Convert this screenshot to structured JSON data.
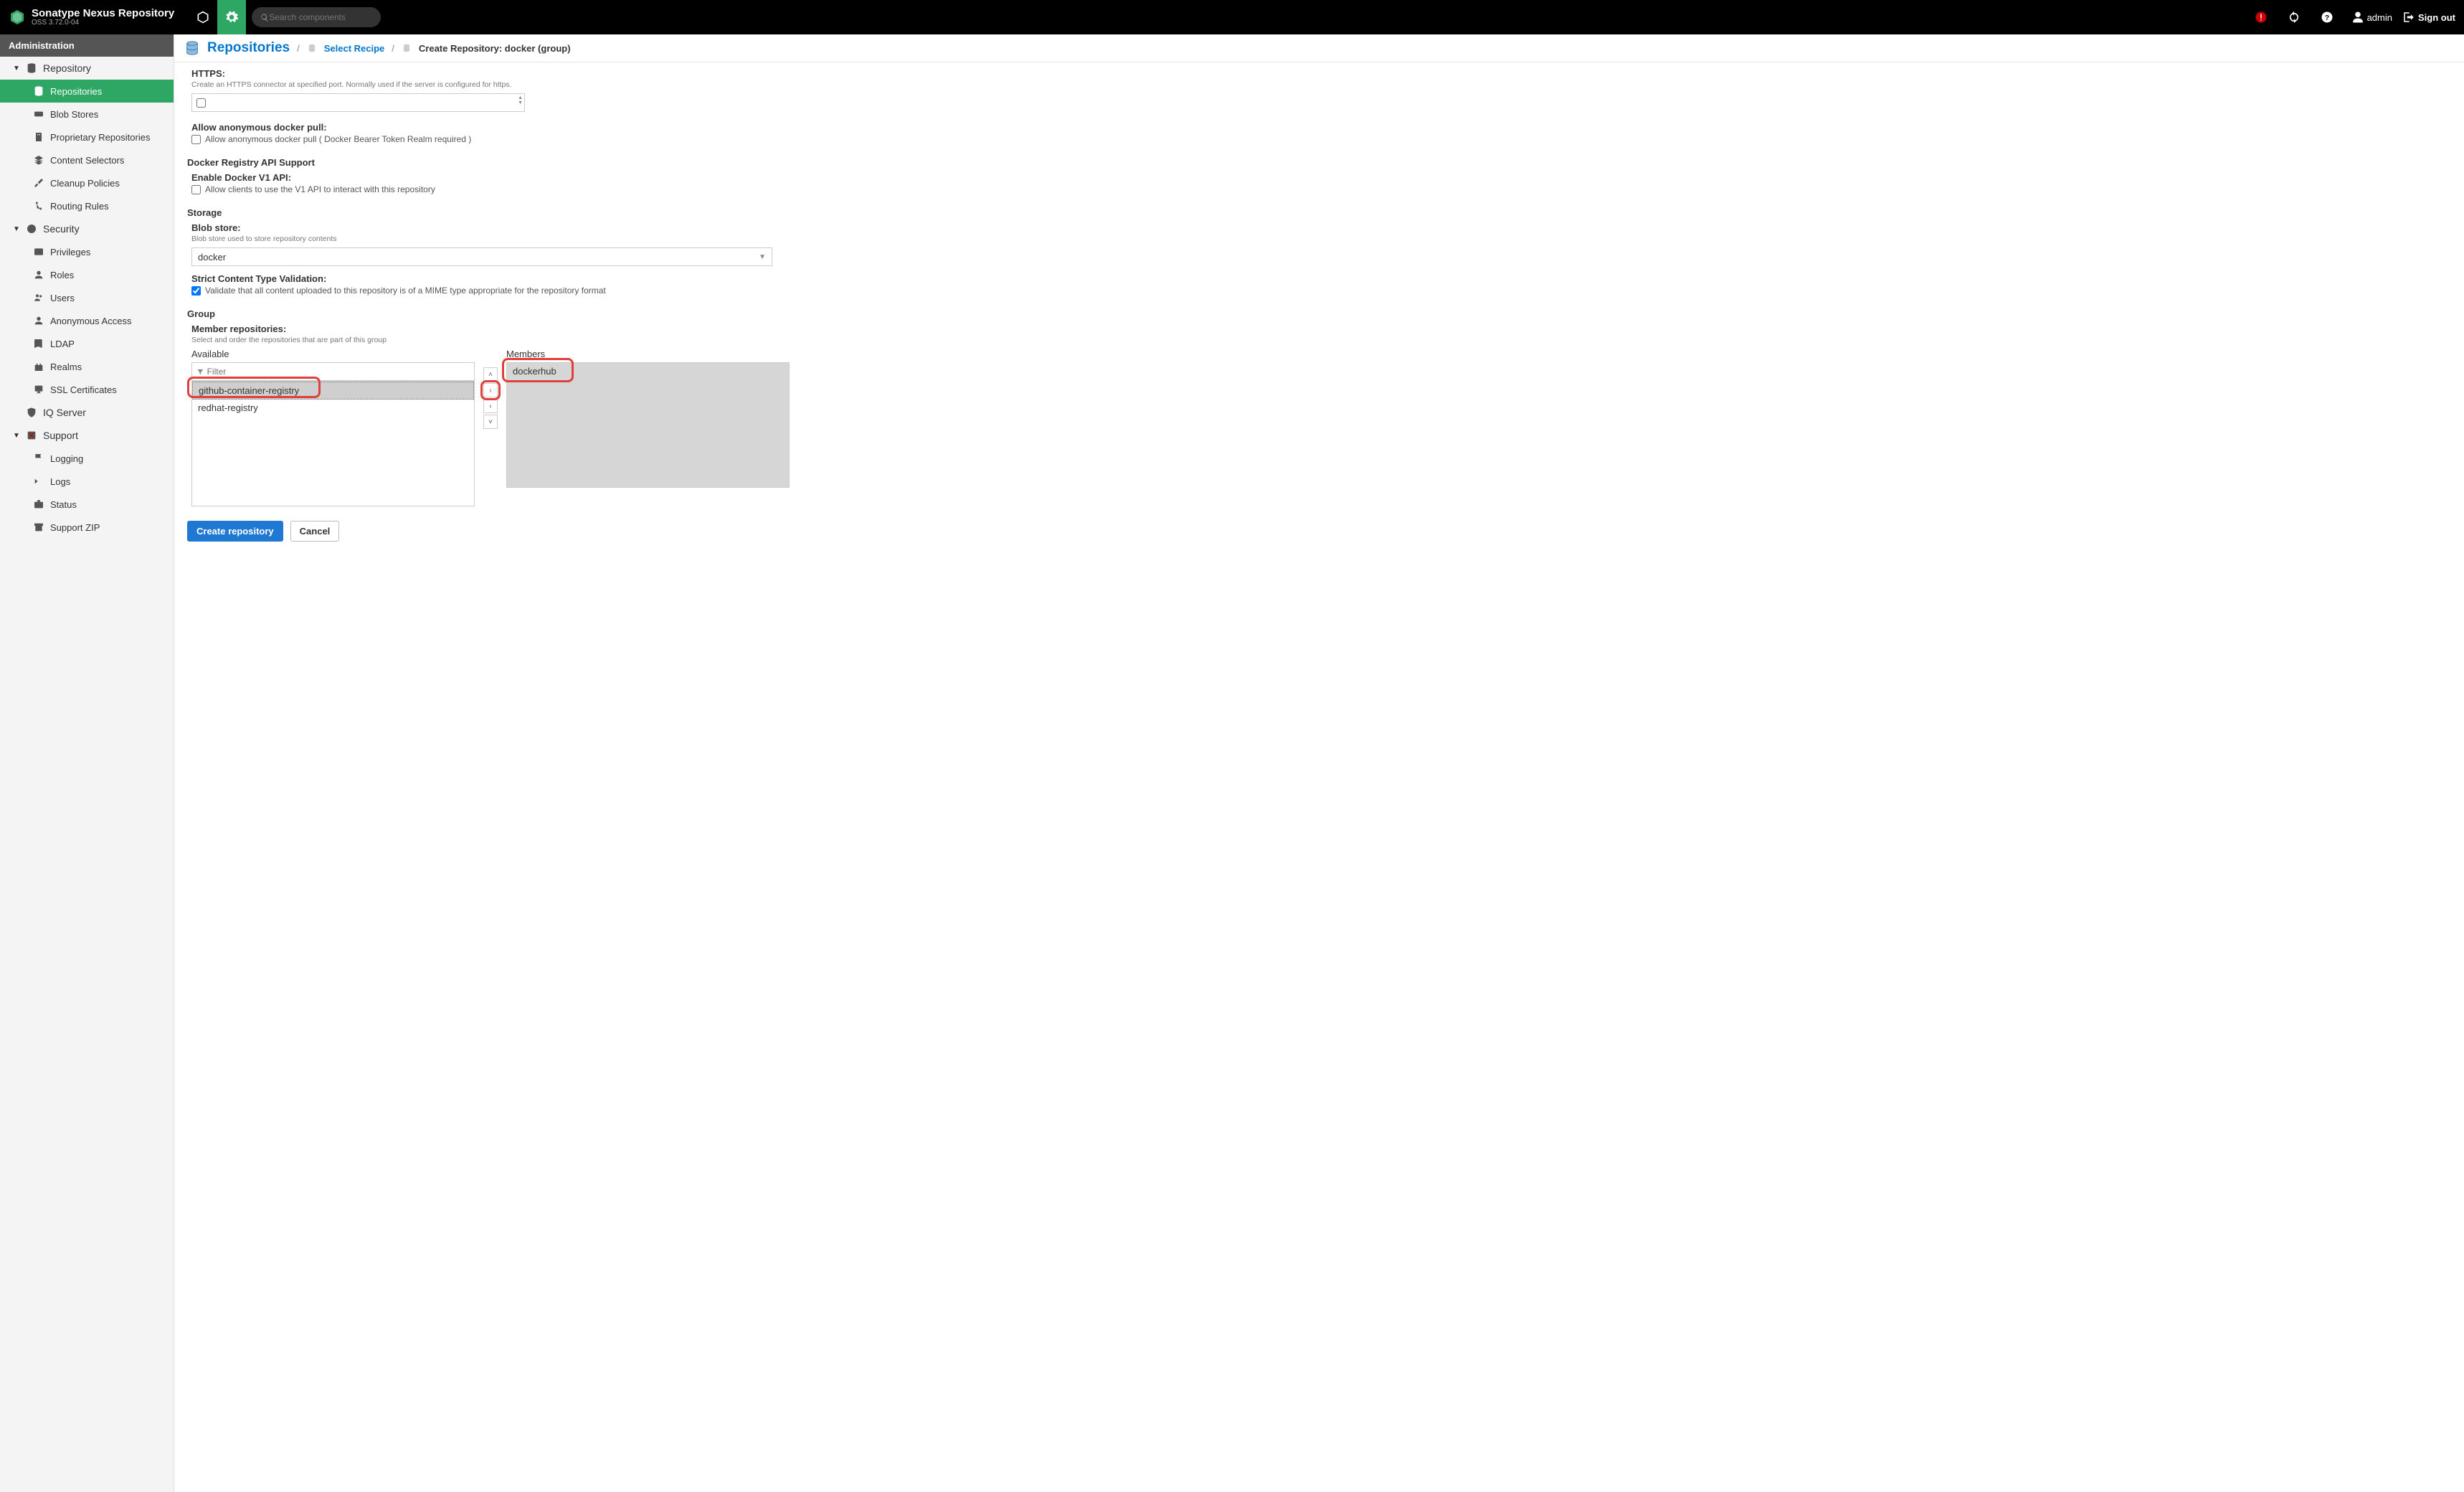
{
  "header": {
    "brand_title": "Sonatype Nexus Repository",
    "brand_sub": "OSS 3.72.0-04",
    "search_placeholder": "Search components",
    "user": "admin",
    "signout": "Sign out"
  },
  "sidebar": {
    "admin_label": "Administration",
    "groups": [
      {
        "label": "Repository",
        "items": [
          {
            "label": "Repositories",
            "selected": true,
            "icon": "database"
          },
          {
            "label": "Blob Stores",
            "icon": "hdd"
          },
          {
            "label": "Proprietary Repositories",
            "icon": "building"
          },
          {
            "label": "Content Selectors",
            "icon": "layers"
          },
          {
            "label": "Cleanup Policies",
            "icon": "broom"
          },
          {
            "label": "Routing Rules",
            "icon": "route"
          }
        ]
      },
      {
        "label": "Security",
        "items": [
          {
            "label": "Privileges",
            "icon": "id"
          },
          {
            "label": "Roles",
            "icon": "user-role"
          },
          {
            "label": "Users",
            "icon": "users"
          },
          {
            "label": "Anonymous Access",
            "icon": "person"
          },
          {
            "label": "LDAP",
            "icon": "book"
          },
          {
            "label": "Realms",
            "icon": "castle"
          },
          {
            "label": "SSL Certificates",
            "icon": "cert"
          }
        ]
      },
      {
        "label": "IQ Server",
        "items": [],
        "icon": "shield",
        "no_arrow": true
      },
      {
        "label": "Support",
        "items": [
          {
            "label": "Logging",
            "icon": "flag"
          },
          {
            "label": "Logs",
            "icon": "terminal"
          },
          {
            "label": "Status",
            "icon": "briefcase"
          },
          {
            "label": "Support ZIP",
            "icon": "archive"
          }
        ]
      }
    ]
  },
  "breadcrumb": {
    "main": "Repositories",
    "link": "Select Recipe",
    "current": "Create Repository: docker (group)"
  },
  "form": {
    "https": {
      "label": "HTTPS:",
      "desc": "Create an HTTPS connector at specified port. Normally used if the server is configured for https."
    },
    "anon": {
      "label": "Allow anonymous docker pull:",
      "chk_label": "Allow anonymous docker pull ( Docker Bearer Token Realm required )"
    },
    "api_section": "Docker Registry API Support",
    "v1": {
      "label": "Enable Docker V1 API:",
      "chk_label": "Allow clients to use the V1 API to interact with this repository"
    },
    "storage_section": "Storage",
    "blob": {
      "label": "Blob store:",
      "desc": "Blob store used to store repository contents",
      "value": "docker"
    },
    "strict": {
      "label": "Strict Content Type Validation:",
      "chk_label": "Validate that all content uploaded to this repository is of a MIME type appropriate for the repository format"
    },
    "group_section": "Group",
    "members": {
      "label": "Member repositories:",
      "desc": "Select and order the repositories that are part of this group",
      "available_label": "Available",
      "members_label": "Members",
      "filter_placeholder": "Filter",
      "available": [
        "github-container-registry",
        "redhat-registry"
      ],
      "members_list": [
        "dockerhub"
      ]
    },
    "buttons": {
      "create": "Create repository",
      "cancel": "Cancel"
    }
  }
}
